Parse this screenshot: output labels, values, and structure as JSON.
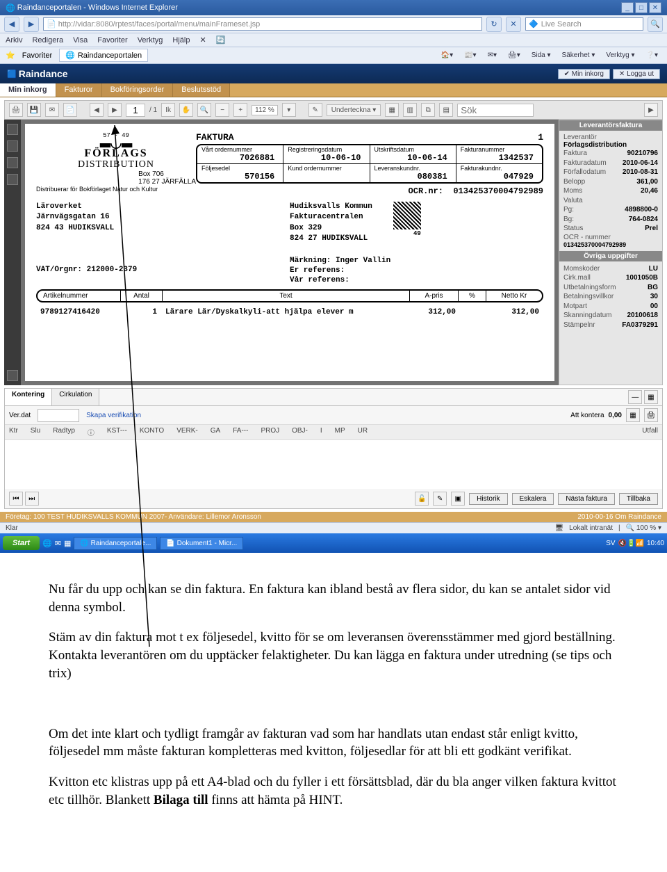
{
  "window": {
    "title": "Raindanceportalen - Windows Internet Explorer"
  },
  "addr": {
    "url": "http://vidar:8080/rptest/faces/portal/menu/mainFrameset.jsp",
    "search_placeholder": "Live Search"
  },
  "menubar": {
    "arkiv": "Arkiv",
    "redigera": "Redigera",
    "visa": "Visa",
    "favoriter": "Favoriter",
    "verktyg": "Verktyg",
    "hjalp": "Hjälp"
  },
  "favbar": {
    "fav": "Favoriter",
    "tab": "Raindanceportalen"
  },
  "ietools": {
    "sida": "Sida ▾",
    "sakerhet": "Säkerhet ▾",
    "verktyg": "Verktyg ▾"
  },
  "raindance": {
    "app": "Raindance",
    "inkorg": "Min inkorg",
    "logga": "Logga ut"
  },
  "tabs": {
    "t1": "Min inkorg",
    "t2": "Fakturor",
    "t3": "Bokföringsorder",
    "t4": "Beslutsstöd"
  },
  "pdf": {
    "page": "1",
    "pages": "/ 1",
    "zoom": "112 %",
    "underteckna": "Underteckna ▾",
    "sok": "Sök"
  },
  "invoice": {
    "small": "57 - 49",
    "forlags1": "FÖRLAGS",
    "forlags2": "DISTRIBUTION",
    "box1": "Box 706",
    "box2": "176 27 JÄRFÄLLA",
    "dist": "Distribuerar för Bokförlaget Natur och Kultur",
    "title": "FAKTURA",
    "titleno": "1",
    "h1": "Vårt ordernummer",
    "v1": "7026881",
    "h2": "Registreringsdatum",
    "v2": "10-06-10",
    "h3": "Utskriftsdatum",
    "v3": "10-06-14",
    "h4": "Fakturanummer",
    "v4": "1342537",
    "h5": "Följesedel",
    "v5": "570156",
    "h6": "Kund ordernummer",
    "v6": "",
    "h7": "Leveranskundnr.",
    "v7": "080381",
    "h8": "Fakturakundnr.",
    "v8": "047929",
    "ocr_lbl": "OCR.nr:",
    "ocr": "013425370004792989",
    "addr1a": "Läroverket",
    "addr1b": "Järnvägsgatan 16",
    "addr1c": "824 43 HUDIKSVALL",
    "addr2a": "Hudiksvalls Kommun",
    "addr2b": "Fakturacentralen",
    "addr2c": "Box 329",
    "addr2d": "824 27 HUDIKSVALL",
    "addr2e": "49",
    "vat": "VAT/Orgnr: 212000-2379",
    "mark": "Märkning: Inger Vallin",
    "eref": "Er referens:",
    "vref": "Vår referens:",
    "col1": "Artikelnummer",
    "col2": "Antal",
    "col3": "Text",
    "col4": "A-pris",
    "col5": "%",
    "col6": "Netto Kr",
    "l_art": "9789127416420",
    "l_ant": "1",
    "l_txt": "Lärare Lär/Dyskalkyli-att hjälpa elever m",
    "l_apr": "312,00",
    "l_net": "312,00"
  },
  "side1": {
    "hdr": "Leverantörsfaktura",
    "lev_lbl": "Leverantör",
    "lev": "Förlagsdistribution",
    "faktura_lbl": "Faktura",
    "faktura": "90210796",
    "fdat_lbl": "Fakturadatum",
    "fdat": "2010-06-14",
    "forf_lbl": "Förfallodatum",
    "forf": "2010-08-31",
    "bel_lbl": "Belopp",
    "bel": "361,00",
    "moms_lbl": "Moms",
    "moms": "20,46",
    "val_lbl": "Valuta",
    "val": "",
    "pg_lbl": "Pg:",
    "pg": "4898800-0",
    "bg_lbl": "Bg:",
    "bg": "764-0824",
    "stat_lbl": "Status",
    "stat": "Prel",
    "ocr_lbl": "OCR - nummer",
    "ocr": "013425370004792989"
  },
  "side2": {
    "hdr": "Övriga uppgifter",
    "mk_lbl": "Momskoder",
    "mk": "LU",
    "cm_lbl": "Cirk.mall",
    "cm": "1001050B",
    "ub_lbl": "Utbetalningsform",
    "ub": "BG",
    "bv_lbl": "Betalningsvillkor",
    "bv": "30",
    "mp_lbl": "Motpart",
    "mp": "00",
    "sk_lbl": "Skanningdatum",
    "sk": "20100618",
    "st_lbl": "Stämpelnr",
    "st": "FA0379291"
  },
  "kont": {
    "tab1": "Kontering",
    "tab2": "Cirkulation",
    "verdat": "Ver.dat",
    "skapa": "Skapa verifikation",
    "attk_lbl": "Att kontera",
    "attk": "0,00",
    "c1": "Ktr",
    "c2": "Slu",
    "c3": "Radtyp",
    "c4": "KST---",
    "c5": "KONTO",
    "c6": "VERK-",
    "c7": "GA",
    "c8": "FA---",
    "c9": "PROJ",
    "c10": "OBJ-",
    "c11": "I",
    "c12": "MP",
    "c13": "UR",
    "c14": "Utfall",
    "b1": "Historik",
    "b2": "Eskalera",
    "b3": "Nästa faktura",
    "b4": "Tillbaka"
  },
  "status": {
    "left": "Företag: 100 TEST HUDIKSVALLS KOMMUN 2007-   Användare: Lillemor Aronsson",
    "right": "2010-00-16  Om Raindance"
  },
  "iestatus": {
    "klar": "Klar",
    "lokalt": "Lokalt intranät",
    "zoom": "100 %"
  },
  "taskbar": {
    "start": "Start",
    "t1": "Raindanceportale...",
    "t2": "Dokument1 - Micr...",
    "lang": "SV",
    "time": "10:40"
  },
  "doc": {
    "p1": "Nu får du upp och kan se din faktura. En faktura kan ibland bestå av flera sidor, du kan se antalet sidor vid denna symbol.",
    "p2": "Stäm av din faktura mot t ex följesedel, kvitto för se om leveransen överensstämmer med gjord beställning. Kontakta leverantören om du upptäcker felaktigheter. Du kan lägga en faktura under utredning (se tips och trix)",
    "p3": "Om det inte klart och tydligt framgår av fakturan vad som har handlats utan endast står enligt kvitto, följesedel mm måste fakturan kompletteras med kvitton, följesedlar för att bli ett godkänt verifikat.",
    "p4a": "Kvitton etc klistras upp på ett A4-blad och du fyller i ett försättsblad, där du bla anger vilken faktura kvittot etc tillhör. Blankett ",
    "p4b": "Bilaga till",
    "p4c": " finns att hämta på HINT."
  }
}
